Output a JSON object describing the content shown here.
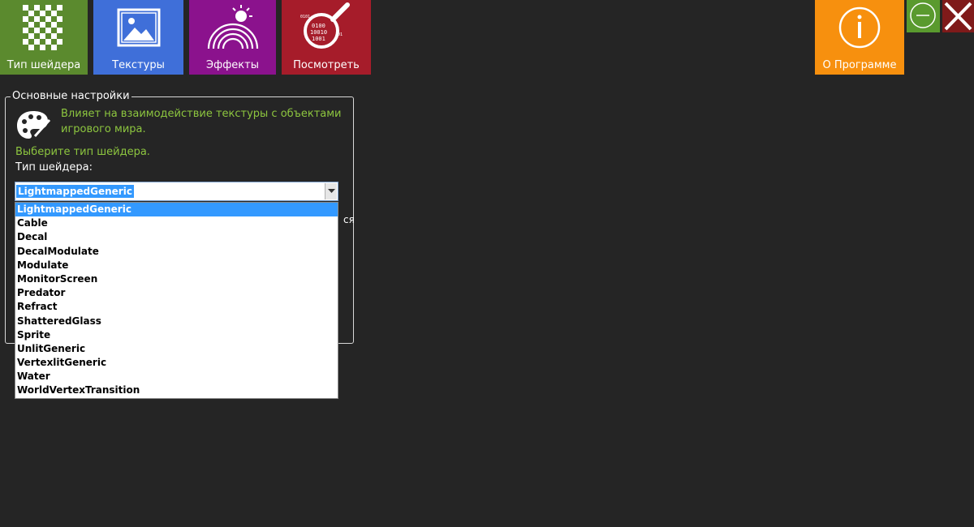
{
  "toolbar": {
    "tiles": [
      {
        "label": "Тип шейдера",
        "icon": "checkerboard-icon",
        "color": "#5b8a2e"
      },
      {
        "label": "Текстуры",
        "icon": "picture-icon",
        "color": "#3f6fd9"
      },
      {
        "label": "Эффекты",
        "icon": "rainbow-sun-icon",
        "color": "#8b128d"
      },
      {
        "label": "Посмотреть",
        "icon": "magnifier-binary-icon",
        "color": "#a61c2a"
      }
    ],
    "about": {
      "label": "О Программе",
      "icon": "info-icon",
      "color": "#f7900e"
    }
  },
  "window_controls": {
    "minimize_icon": "minus-circle-icon",
    "close_icon": "close-icon"
  },
  "settings": {
    "legend": "Основные настройки",
    "description": "Влияет на взаимодействие текстуры с объектами игрового мира.",
    "prompt": "Выберите тип шейдера.",
    "field_label": "Тип шейдера:",
    "partially_hidden_text": "ся"
  },
  "shader_select": {
    "value": "LightmappedGeneric",
    "options": [
      "LightmappedGeneric",
      "Cable",
      "Decal",
      "DecalModulate",
      "Modulate",
      "MonitorScreen",
      "Predator",
      "Refract",
      "ShatteredGlass",
      "Sprite",
      "UnlitGeneric",
      "VertexlitGeneric",
      "Water",
      "WorldVertexTransition"
    ],
    "selected_index": 0
  },
  "colors": {
    "background": "#252525",
    "accent_green_text": "#8dc63f",
    "selection": "#3399ff"
  }
}
